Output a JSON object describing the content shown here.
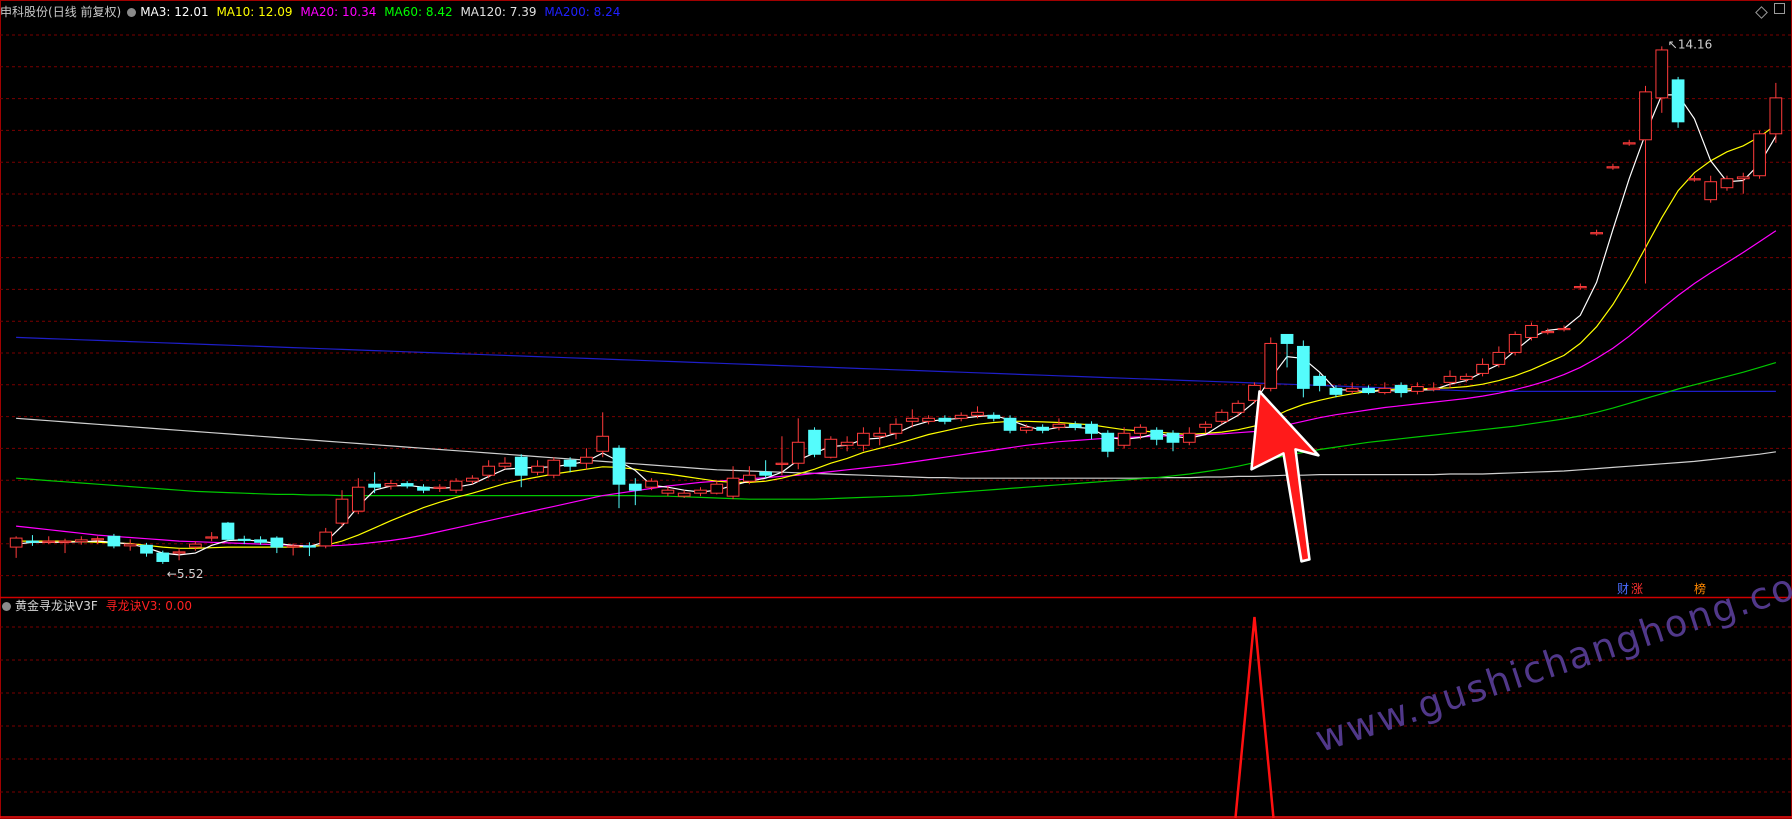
{
  "header": {
    "stock_name": "申科股份",
    "period": "(日线 前复权)",
    "ma3": "MA3: 12.01",
    "ma10": "MA10: 12.09",
    "ma20": "MA20: 10.34",
    "ma60": "MA60: 8.42",
    "ma120": "MA120: 7.39",
    "ma200": "MA200: 8.24"
  },
  "indicator": {
    "name": "黄金寻龙诀V3F",
    "value_label": "寻龙诀V3: 0.00"
  },
  "colors": {
    "up": "#ff3b3b",
    "down": "#54fcfc",
    "ma3": "#ffffff",
    "ma10": "#ffff00",
    "ma20": "#ff00ff",
    "ma60": "#00c800",
    "ma120": "#d0d0d0",
    "ma200": "#1e1ec8",
    "grid": "#7a0000"
  },
  "watermark": "www.gushichanghong.com",
  "badges": [
    "财",
    "涨",
    "榜"
  ],
  "chart_data": {
    "type": "candlestick",
    "ylim": [
      5.0,
      14.6
    ],
    "high_label": "14.16",
    "low_label": "5.52",
    "candles": [
      [
        5.8,
        5.95,
        5.62,
        5.98
      ],
      [
        5.9,
        5.88,
        5.82,
        6.0
      ],
      [
        5.88,
        5.9,
        5.85,
        5.98
      ],
      [
        5.88,
        5.9,
        5.7,
        5.94
      ],
      [
        5.89,
        5.92,
        5.84,
        5.98
      ],
      [
        5.92,
        5.94,
        5.85,
        5.98
      ],
      [
        5.98,
        5.82,
        5.78,
        6.02
      ],
      [
        5.82,
        5.85,
        5.74,
        5.93
      ],
      [
        5.83,
        5.7,
        5.64,
        5.87
      ],
      [
        5.7,
        5.56,
        5.52,
        5.74
      ],
      [
        5.7,
        5.72,
        5.58,
        5.78
      ],
      [
        5.8,
        5.85,
        5.74,
        5.9
      ],
      [
        5.95,
        5.97,
        5.9,
        6.05
      ],
      [
        6.2,
        5.93,
        5.9,
        6.22
      ],
      [
        5.93,
        5.92,
        5.85,
        5.99
      ],
      [
        5.92,
        5.88,
        5.84,
        5.98
      ],
      [
        5.95,
        5.8,
        5.7,
        5.98
      ],
      [
        5.8,
        5.82,
        5.66,
        5.86
      ],
      [
        5.82,
        5.8,
        5.65,
        5.88
      ],
      [
        5.82,
        6.05,
        5.78,
        6.12
      ],
      [
        6.2,
        6.6,
        6.15,
        6.75
      ],
      [
        6.4,
        6.8,
        6.35,
        6.95
      ],
      [
        6.85,
        6.8,
        6.7,
        7.05
      ],
      [
        6.82,
        6.86,
        6.76,
        6.92
      ],
      [
        6.86,
        6.82,
        6.78,
        6.9
      ],
      [
        6.8,
        6.75,
        6.7,
        6.85
      ],
      [
        6.8,
        6.8,
        6.72,
        6.85
      ],
      [
        6.75,
        6.9,
        6.7,
        6.95
      ],
      [
        6.9,
        6.95,
        6.85,
        7.0
      ],
      [
        7.0,
        7.15,
        6.95,
        7.25
      ],
      [
        7.15,
        7.2,
        7.1,
        7.3
      ],
      [
        7.3,
        7.0,
        6.8,
        7.35
      ],
      [
        7.05,
        7.15,
        7.0,
        7.25
      ],
      [
        7.0,
        7.25,
        6.95,
        7.3
      ],
      [
        7.25,
        7.15,
        7.05,
        7.3
      ],
      [
        7.2,
        7.3,
        7.1,
        7.45
      ],
      [
        7.4,
        7.65,
        7.3,
        8.05
      ],
      [
        7.45,
        6.85,
        6.45,
        7.5
      ],
      [
        6.85,
        6.75,
        6.5,
        6.95
      ],
      [
        6.8,
        6.9,
        6.75,
        6.95
      ],
      [
        6.7,
        6.75,
        6.65,
        6.82
      ],
      [
        6.65,
        6.7,
        6.62,
        6.75
      ],
      [
        6.7,
        6.75,
        6.65,
        6.8
      ],
      [
        6.7,
        6.85,
        6.68,
        6.9
      ],
      [
        6.65,
        6.95,
        6.6,
        7.15
      ],
      [
        6.9,
        7.0,
        6.85,
        7.15
      ],
      [
        7.05,
        7.0,
        6.95,
        7.25
      ],
      [
        7.2,
        7.2,
        7.0,
        7.65
      ],
      [
        7.2,
        7.55,
        7.1,
        7.95
      ],
      [
        7.75,
        7.35,
        7.3,
        7.8
      ],
      [
        7.3,
        7.6,
        7.28,
        7.65
      ],
      [
        7.5,
        7.55,
        7.4,
        7.65
      ],
      [
        7.5,
        7.7,
        7.4,
        7.8
      ],
      [
        7.65,
        7.7,
        7.5,
        7.8
      ],
      [
        7.7,
        7.85,
        7.6,
        7.95
      ],
      [
        7.9,
        7.95,
        7.8,
        8.1
      ],
      [
        7.9,
        7.95,
        7.85,
        8.0
      ],
      [
        7.95,
        7.9,
        7.85,
        8.0
      ],
      [
        7.95,
        8.0,
        7.9,
        8.05
      ],
      [
        8.0,
        8.05,
        7.95,
        8.15
      ],
      [
        8.0,
        7.95,
        7.9,
        8.05
      ],
      [
        7.95,
        7.75,
        7.7,
        8.0
      ],
      [
        7.75,
        7.8,
        7.7,
        7.85
      ],
      [
        7.8,
        7.75,
        7.7,
        7.85
      ],
      [
        7.8,
        7.85,
        7.75,
        7.95
      ],
      [
        7.85,
        7.8,
        7.75,
        7.9
      ],
      [
        7.85,
        7.7,
        7.6,
        7.9
      ],
      [
        7.7,
        7.4,
        7.3,
        7.75
      ],
      [
        7.5,
        7.7,
        7.45,
        7.8
      ],
      [
        7.7,
        7.8,
        7.6,
        7.85
      ],
      [
        7.75,
        7.6,
        7.5,
        7.8
      ],
      [
        7.7,
        7.55,
        7.4,
        7.75
      ],
      [
        7.55,
        7.7,
        7.5,
        7.8
      ],
      [
        7.8,
        7.85,
        7.7,
        7.9
      ],
      [
        7.9,
        8.05,
        7.85,
        8.1
      ],
      [
        8.05,
        8.2,
        8.0,
        8.25
      ],
      [
        8.25,
        8.5,
        8.2,
        8.55
      ],
      [
        8.45,
        9.2,
        8.4,
        9.3
      ],
      [
        9.35,
        9.2,
        8.8,
        9.35
      ],
      [
        9.15,
        8.45,
        8.3,
        9.25
      ],
      [
        8.65,
        8.5,
        8.4,
        8.7
      ],
      [
        8.45,
        8.35,
        8.3,
        8.5
      ],
      [
        8.4,
        8.45,
        8.35,
        8.55
      ],
      [
        8.45,
        8.38,
        8.35,
        8.5
      ],
      [
        8.38,
        8.45,
        8.35,
        8.55
      ],
      [
        8.5,
        8.38,
        8.3,
        8.55
      ],
      [
        8.4,
        8.48,
        8.35,
        8.55
      ],
      [
        8.45,
        8.45,
        8.4,
        8.55
      ],
      [
        8.55,
        8.65,
        8.45,
        8.75
      ],
      [
        8.6,
        8.65,
        8.55,
        8.7
      ],
      [
        8.7,
        8.85,
        8.65,
        8.95
      ],
      [
        8.85,
        9.05,
        8.8,
        9.15
      ],
      [
        9.05,
        9.35,
        9.0,
        9.4
      ],
      [
        9.3,
        9.5,
        9.25,
        9.55
      ],
      [
        9.4,
        9.4,
        9.35,
        9.45
      ],
      [
        9.45,
        9.45,
        9.4,
        9.5
      ],
      [
        10.15,
        10.15,
        10.1,
        10.2
      ],
      [
        11.05,
        11.05,
        11.0,
        11.1
      ],
      [
        12.15,
        12.15,
        12.1,
        12.2
      ],
      [
        12.55,
        12.55,
        12.5,
        12.6
      ],
      [
        12.6,
        13.4,
        10.2,
        13.5
      ],
      [
        13.3,
        14.1,
        13.05,
        14.16
      ],
      [
        13.6,
        12.9,
        12.8,
        13.65
      ],
      [
        11.95,
        11.95,
        11.9,
        12.0
      ],
      [
        11.6,
        11.9,
        11.55,
        12.0
      ],
      [
        11.8,
        11.95,
        11.75,
        12.0
      ],
      [
        11.95,
        11.98,
        11.7,
        12.05
      ],
      [
        12.0,
        12.7,
        11.95,
        12.75
      ],
      [
        12.7,
        13.3,
        12.55,
        13.55
      ]
    ],
    "ma3": [
      5.85,
      5.88,
      5.88,
      5.88,
      5.89,
      5.9,
      5.88,
      5.85,
      5.79,
      5.7,
      5.67,
      5.7,
      5.83,
      5.91,
      5.92,
      5.9,
      5.86,
      5.83,
      5.81,
      5.89,
      6.15,
      6.48,
      6.75,
      6.82,
      6.83,
      6.8,
      6.78,
      6.8,
      6.85,
      6.98,
      7.1,
      7.12,
      7.13,
      7.14,
      7.18,
      7.23,
      7.37,
      7.23,
      7.08,
      6.83,
      6.8,
      6.75,
      6.72,
      6.75,
      6.83,
      6.9,
      6.95,
      7.05,
      7.25,
      7.37,
      7.48,
      7.5,
      7.6,
      7.62,
      7.7,
      7.82,
      7.9,
      7.93,
      7.95,
      7.98,
      8.0,
      7.92,
      7.82,
      7.75,
      7.8,
      7.8,
      7.78,
      7.63,
      7.6,
      7.63,
      7.7,
      7.65,
      7.62,
      7.68,
      7.85,
      8.0,
      8.22,
      8.62,
      8.98,
      8.95,
      8.72,
      8.43,
      8.42,
      8.39,
      8.42,
      8.4,
      8.42,
      8.43,
      8.52,
      8.58,
      8.72,
      8.85,
      9.08,
      9.3,
      9.42,
      9.45,
      9.67,
      10.22,
      11.1,
      11.95,
      12.7,
      13.35,
      13.35,
      12.95,
      12.25,
      11.9,
      11.92,
      12.2,
      12.66
    ],
    "ma10": [
      5.9,
      5.9,
      5.9,
      5.9,
      5.89,
      5.88,
      5.87,
      5.86,
      5.83,
      5.8,
      5.78,
      5.78,
      5.79,
      5.8,
      5.8,
      5.8,
      5.8,
      5.8,
      5.81,
      5.83,
      5.9,
      6.0,
      6.12,
      6.24,
      6.35,
      6.46,
      6.55,
      6.63,
      6.7,
      6.78,
      6.86,
      6.92,
      6.97,
      7.02,
      7.06,
      7.1,
      7.14,
      7.13,
      7.1,
      7.05,
      7.02,
      6.98,
      6.94,
      6.9,
      6.88,
      6.88,
      6.9,
      6.95,
      7.02,
      7.1,
      7.2,
      7.28,
      7.38,
      7.45,
      7.52,
      7.6,
      7.68,
      7.74,
      7.8,
      7.85,
      7.88,
      7.9,
      7.9,
      7.89,
      7.88,
      7.86,
      7.84,
      7.8,
      7.76,
      7.74,
      7.72,
      7.7,
      7.68,
      7.7,
      7.72,
      7.76,
      7.82,
      7.95,
      8.08,
      8.18,
      8.25,
      8.31,
      8.36,
      8.4,
      8.43,
      8.44,
      8.44,
      8.45,
      8.46,
      8.48,
      8.52,
      8.58,
      8.66,
      8.76,
      8.88,
      9.0,
      9.2,
      9.48,
      9.85,
      10.3,
      10.8,
      11.3,
      11.75,
      12.05,
      12.25,
      12.4,
      12.5,
      12.65,
      12.85
    ],
    "ma20": [
      6.15,
      6.12,
      6.09,
      6.06,
      6.03,
      6.0,
      5.98,
      5.96,
      5.94,
      5.92,
      5.9,
      5.89,
      5.88,
      5.87,
      5.86,
      5.85,
      5.84,
      5.83,
      5.82,
      5.82,
      5.83,
      5.85,
      5.88,
      5.91,
      5.95,
      6.0,
      6.06,
      6.12,
      6.18,
      6.24,
      6.3,
      6.36,
      6.42,
      6.48,
      6.54,
      6.6,
      6.66,
      6.7,
      6.74,
      6.78,
      6.82,
      6.85,
      6.88,
      6.9,
      6.92,
      6.94,
      6.96,
      6.98,
      7.0,
      7.03,
      7.06,
      7.09,
      7.12,
      7.15,
      7.18,
      7.22,
      7.26,
      7.3,
      7.34,
      7.38,
      7.42,
      7.46,
      7.5,
      7.53,
      7.56,
      7.58,
      7.6,
      7.62,
      7.63,
      7.64,
      7.65,
      7.66,
      7.67,
      7.68,
      7.69,
      7.71,
      7.73,
      7.78,
      7.84,
      7.9,
      7.96,
      8.01,
      8.05,
      8.09,
      8.13,
      8.16,
      8.19,
      8.22,
      8.25,
      8.28,
      8.32,
      8.37,
      8.43,
      8.5,
      8.58,
      8.68,
      8.8,
      8.95,
      9.12,
      9.32,
      9.55,
      9.78,
      10.0,
      10.2,
      10.38,
      10.55,
      10.72,
      10.9,
      11.08
    ],
    "ma60": [
      6.95,
      6.93,
      6.91,
      6.89,
      6.87,
      6.85,
      6.83,
      6.81,
      6.79,
      6.77,
      6.75,
      6.73,
      6.72,
      6.71,
      6.7,
      6.69,
      6.68,
      6.68,
      6.67,
      6.67,
      6.66,
      6.66,
      6.66,
      6.66,
      6.66,
      6.66,
      6.66,
      6.66,
      6.66,
      6.66,
      6.66,
      6.66,
      6.66,
      6.66,
      6.66,
      6.66,
      6.66,
      6.66,
      6.66,
      6.65,
      6.65,
      6.64,
      6.63,
      6.62,
      6.61,
      6.6,
      6.6,
      6.6,
      6.6,
      6.6,
      6.61,
      6.62,
      6.63,
      6.64,
      6.65,
      6.66,
      6.68,
      6.7,
      6.72,
      6.74,
      6.76,
      6.78,
      6.8,
      6.82,
      6.84,
      6.86,
      6.88,
      6.9,
      6.92,
      6.94,
      6.96,
      6.99,
      7.02,
      7.06,
      7.1,
      7.15,
      7.21,
      7.27,
      7.33,
      7.38,
      7.43,
      7.47,
      7.51,
      7.55,
      7.58,
      7.61,
      7.64,
      7.67,
      7.7,
      7.73,
      7.76,
      7.79,
      7.82,
      7.86,
      7.9,
      7.94,
      7.99,
      8.05,
      8.12,
      8.2,
      8.28,
      8.36,
      8.44,
      8.51,
      8.58,
      8.65,
      8.72,
      8.8,
      8.88
    ],
    "ma120": [
      7.95,
      7.93,
      7.91,
      7.89,
      7.87,
      7.85,
      7.83,
      7.81,
      7.79,
      7.77,
      7.75,
      7.73,
      7.71,
      7.69,
      7.67,
      7.65,
      7.63,
      7.61,
      7.59,
      7.57,
      7.55,
      7.53,
      7.51,
      7.49,
      7.47,
      7.45,
      7.43,
      7.41,
      7.39,
      7.37,
      7.35,
      7.33,
      7.31,
      7.29,
      7.27,
      7.25,
      7.23,
      7.21,
      7.19,
      7.17,
      7.15,
      7.13,
      7.11,
      7.09,
      7.08,
      7.07,
      7.06,
      7.05,
      7.04,
      7.03,
      7.02,
      7.01,
      7.0,
      6.99,
      6.98,
      6.97,
      6.96,
      6.96,
      6.95,
      6.95,
      6.95,
      6.95,
      6.95,
      6.95,
      6.95,
      6.95,
      6.95,
      6.95,
      6.95,
      6.95,
      6.96,
      6.96,
      6.96,
      6.97,
      6.97,
      6.98,
      6.98,
      6.99,
      7.0,
      7.0,
      7.01,
      7.01,
      7.01,
      7.01,
      7.01,
      7.01,
      7.01,
      7.01,
      7.02,
      7.02,
      7.02,
      7.03,
      7.04,
      7.05,
      7.06,
      7.07,
      7.09,
      7.11,
      7.13,
      7.15,
      7.17,
      7.19,
      7.21,
      7.23,
      7.26,
      7.29,
      7.32,
      7.35,
      7.39
    ],
    "ma200": [
      9.3,
      9.29,
      9.28,
      9.27,
      9.26,
      9.25,
      9.24,
      9.23,
      9.22,
      9.21,
      9.2,
      9.19,
      9.18,
      9.17,
      9.16,
      9.15,
      9.14,
      9.13,
      9.12,
      9.11,
      9.1,
      9.09,
      9.08,
      9.07,
      9.06,
      9.05,
      9.04,
      9.03,
      9.02,
      9.01,
      9.0,
      8.99,
      8.98,
      8.97,
      8.96,
      8.95,
      8.94,
      8.93,
      8.92,
      8.91,
      8.9,
      8.89,
      8.88,
      8.87,
      8.86,
      8.85,
      8.84,
      8.83,
      8.82,
      8.81,
      8.8,
      8.79,
      8.78,
      8.77,
      8.76,
      8.75,
      8.74,
      8.73,
      8.72,
      8.71,
      8.7,
      8.69,
      8.68,
      8.67,
      8.66,
      8.65,
      8.64,
      8.63,
      8.62,
      8.61,
      8.6,
      8.59,
      8.58,
      8.57,
      8.56,
      8.55,
      8.54,
      8.53,
      8.52,
      8.51,
      8.5,
      8.49,
      8.48,
      8.47,
      8.46,
      8.45,
      8.44,
      8.43,
      8.42,
      8.41,
      8.4,
      8.4,
      8.4,
      8.4,
      8.4,
      8.4,
      8.4,
      8.4,
      8.4,
      8.4,
      8.4,
      8.4,
      8.4,
      8.4,
      8.4,
      8.4,
      8.4,
      8.4,
      8.4
    ],
    "indicator_signal": {
      "index": 76,
      "value": 1
    },
    "indicator_value": 0.0
  }
}
